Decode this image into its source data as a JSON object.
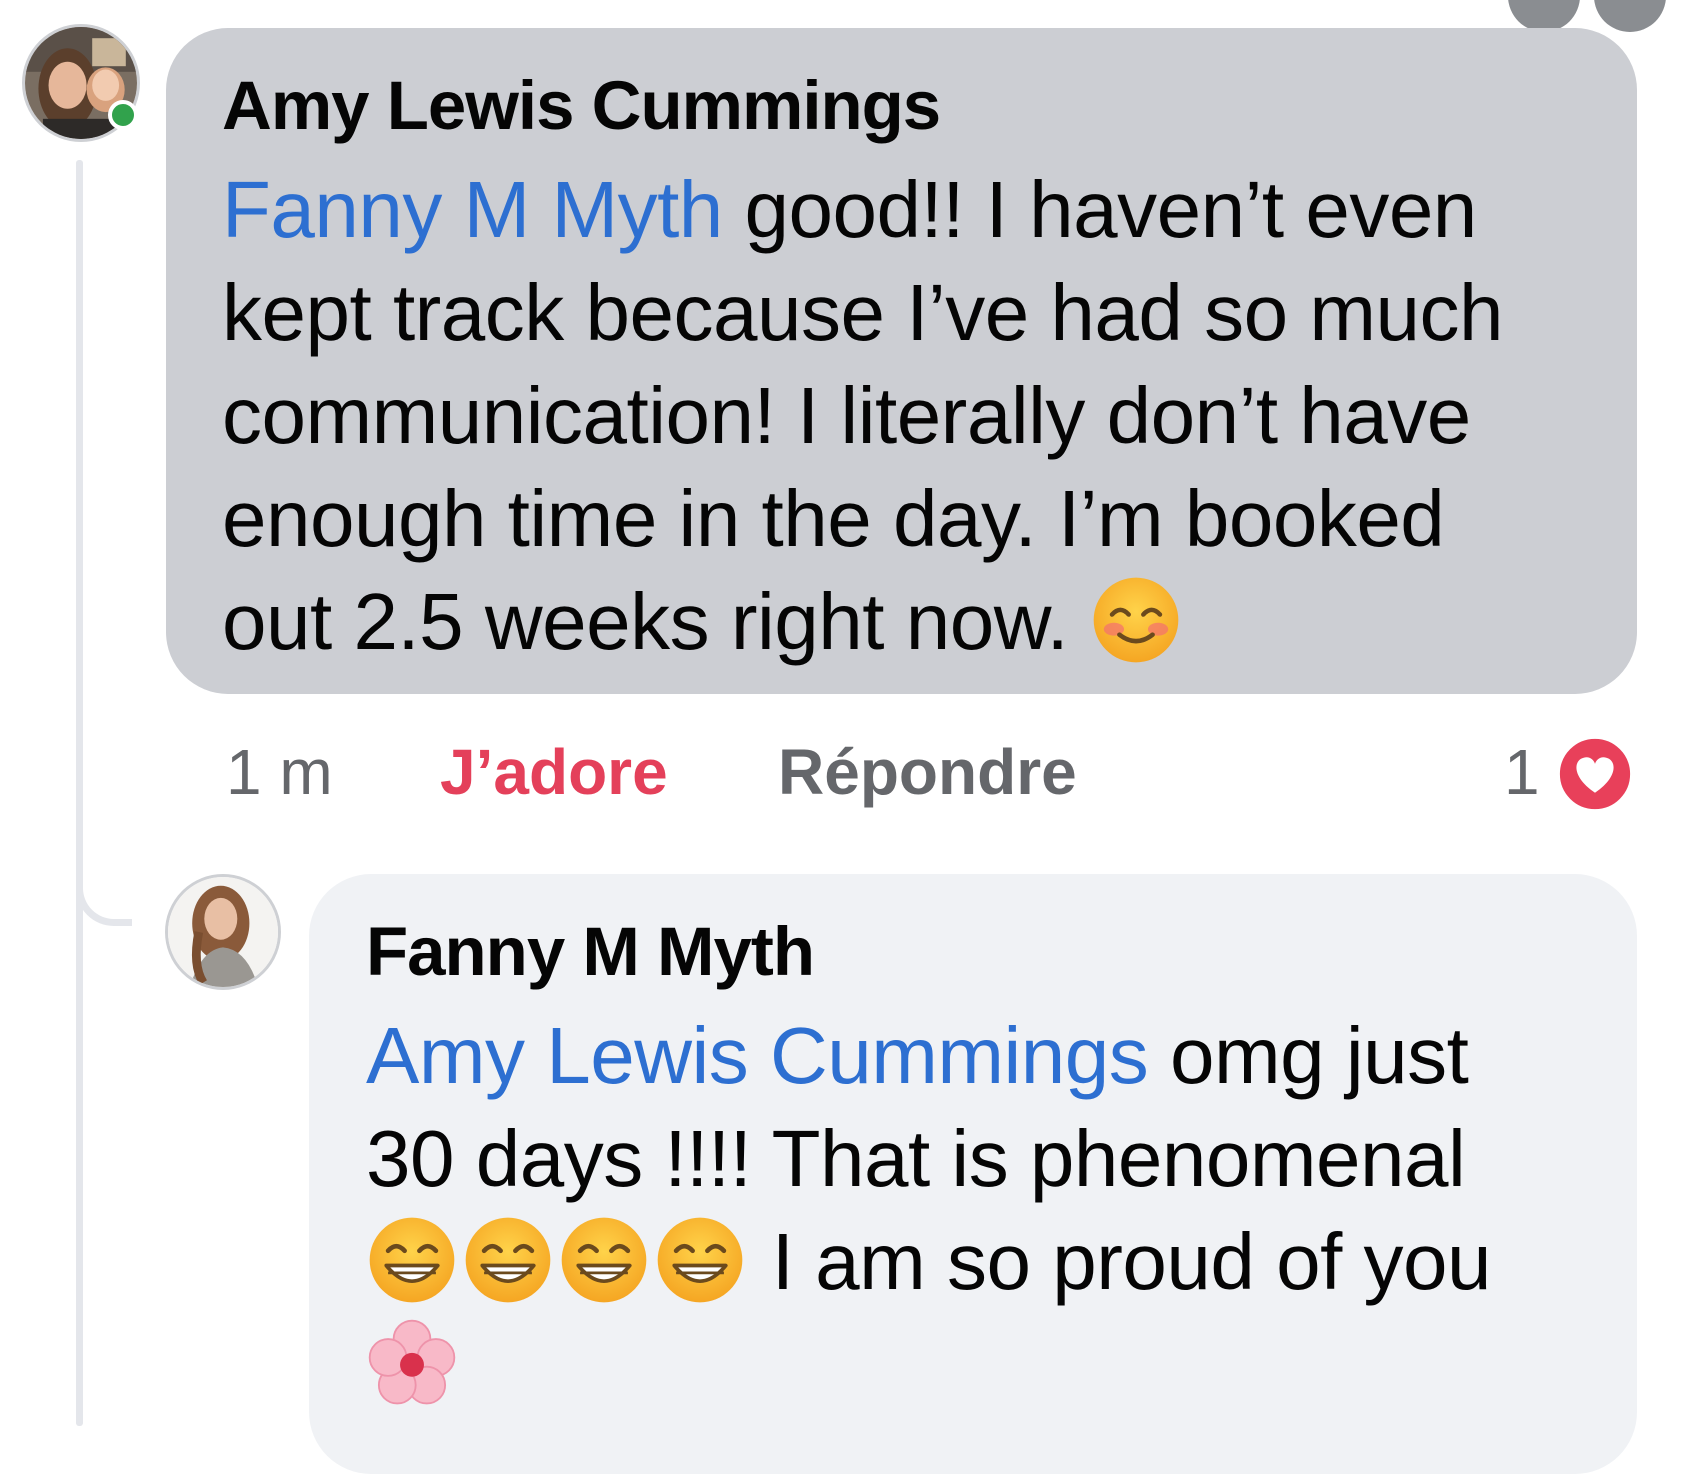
{
  "comment": {
    "author": "Amy Lewis Cummings",
    "mention": "Fanny M Myth",
    "lines": [
      " good!! I haven’t even",
      "kept track because I’ve had so much",
      "communication! I literally don’t have",
      "enough time in the day. I’m booked",
      "out 2.5 weeks right now. "
    ],
    "emoji": "smiling-face-with-smiling-eyes-icon",
    "time": "1 m",
    "love_label": "J’adore",
    "reply_label": "Répondre",
    "reaction_count": "1",
    "reaction_icon": "heart-icon",
    "author_online": true
  },
  "reply": {
    "author": "Fanny M Myth",
    "mention": "Amy Lewis Cummings",
    "lines": [
      " omg just",
      "30 days !!!! That is phenomenal",
      " I am so proud of you"
    ],
    "emojis": [
      "grinning-face-icon",
      "grinning-face-icon",
      "grinning-face-icon",
      "grinning-face-icon",
      "cherry-blossom-icon"
    ]
  },
  "colors": {
    "mention": "#2d6fd1",
    "love": "#e4405a",
    "comment_bubble": "#ccced3",
    "reply_bubble": "#f0f2f5",
    "online": "#31a24c"
  }
}
